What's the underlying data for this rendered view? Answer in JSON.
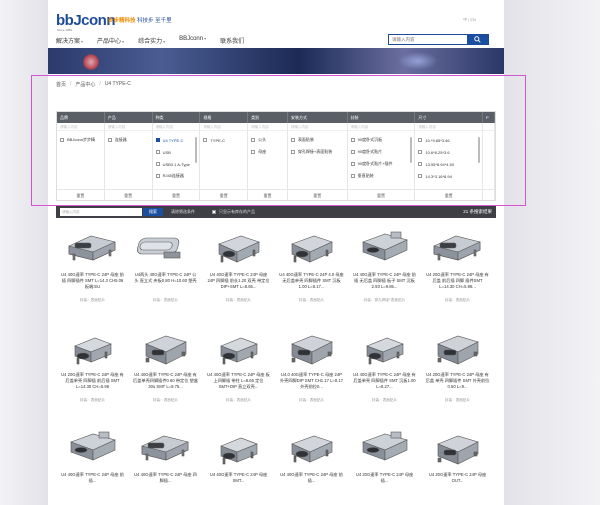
{
  "header": {
    "logo": "bbJconn",
    "logo_sub": "Since 1989",
    "slogan_brand": "步步精科技",
    "slogan_text": "科技步 至千里",
    "lang": "中 | EN",
    "nav": [
      {
        "label": "解决方案",
        "caret": "▾"
      },
      {
        "label": "产品中心",
        "caret": "▾"
      },
      {
        "label": "综合实力",
        "caret": "▾"
      },
      {
        "label": "BBJconn",
        "caret": "▾"
      },
      {
        "label": "联系我们",
        "caret": ""
      }
    ],
    "search_placeholder": "请输入内容"
  },
  "breadcrumb": [
    "首页",
    "产品中心",
    "U4 TYPE-C"
  ],
  "filter": {
    "columns": [
      "品牌",
      "产品",
      "种类",
      "规格",
      "类别",
      "安装方式",
      "封装",
      "尺寸",
      "P"
    ],
    "search_placeholder": "请输入内容",
    "options": {
      "brand": [
        {
          "label": "BBJconn步步精",
          "on": false
        }
      ],
      "product": [
        {
          "label": "连接器",
          "on": false
        }
      ],
      "kind": [
        {
          "label": "U4 TYPE-C",
          "on": true
        },
        {
          "label": "USB",
          "on": false
        },
        {
          "label": "USB3.1 A-Type",
          "on": false
        },
        {
          "label": "RJ45连接器",
          "on": false
        }
      ],
      "spec": [
        {
          "label": "TYPE-C",
          "on": false
        }
      ],
      "category": [
        {
          "label": "公头",
          "on": false
        },
        {
          "label": "母座",
          "on": false
        }
      ],
      "mount": [
        {
          "label": "表面贴装",
          "on": false
        },
        {
          "label": "穿孔焊接+表面贴装",
          "on": false
        }
      ],
      "package": [
        {
          "label": "90度卧式沉板",
          "on": false
        },
        {
          "label": "90度卧式贴片",
          "on": false
        },
        {
          "label": "90度卧式贴片+插件",
          "on": false
        },
        {
          "label": "垂直贴装",
          "on": false
        }
      ],
      "size": [
        {
          "label": "10.*9.85*3.46",
          "on": false
        },
        {
          "label": "10.6*8.25*3.6",
          "on": false
        },
        {
          "label": "13.95*8.94*4.50",
          "on": false
        },
        {
          "label": "14.3*3.16*8.94",
          "on": false
        }
      ]
    },
    "reset": "重置"
  },
  "toolbar": {
    "search_placeholder": "请输入内容",
    "search_btn": "搜索",
    "clear": "清除筛选条件",
    "only_label": "只显示有库存的产品",
    "count": "21 条搜索结果"
  },
  "products": [
    {
      "name": "U4 40G速率 TYPE-C 24P 母座 前插 四脚插件 SMT L=14.3 CH5.06 板端:EU",
      "meta": "封装：表面贴片",
      "shape": "a"
    },
    {
      "name": "U4两头 40G速率 TYPE-C 24P 公头 直立式 夹板0.80 H=10.60 塑壳",
      "meta": "封装：表面贴片",
      "shape": "b"
    },
    {
      "name": "U4 40G速率 TYPE-C 24P 母座 24P 四脚插 前长1.20 双壳 带定位DIP+SMT L=8.65...",
      "meta": "封装：表面贴片",
      "shape": "c"
    },
    {
      "name": "U4 40G速率 TYPE-C 24P 4.0 母座 无后盖单壳 四脚插件 SMT 沉板1.00 L=8.17...",
      "meta": "封装：表面贴片",
      "shape": "c"
    },
    {
      "name": "U4 40G速率 TYPE-C 24P 母座 前插 无后盖 四脚插 板子 SMT 沉板2.93 L=9.85...",
      "meta": "封装：穿孔焊接+表面贴片",
      "shape": "d"
    },
    {
      "name": "U4 20G速率 TYPE-C 24P 母座 有后盖 前后插 四脚 插件SMT L=14.30 CH=5.98...",
      "meta": "封装：表面贴片",
      "shape": "a"
    },
    {
      "name": "U4 20G速率 TYPE-C 24P 母座 有后盖单壳 四脚插 前后插 SMT L=14.30 CH=5.98",
      "meta": "封装：表面贴片",
      "shape": "e"
    },
    {
      "name": "U4 40G速率 TYPE-C 24P 母座 有后盖单壳四脚插件0.60 带定位 塑盒30u SMT L=9.75...",
      "meta": "封装：表面贴片",
      "shape": "f"
    },
    {
      "name": "U4 40G速率 TYPE-C 24P 母座 板上四脚插 带柱 L=8.65 定位SMT+DIP 直立双壳...",
      "meta": "封装：表面贴片",
      "shape": "e"
    },
    {
      "name": "U4.0 40G速率 TYPE-C 母座 24P 外壳四脚DIP SMT CH1.17 L=8.17 外壳前拉0...",
      "meta": "封装：表面贴片",
      "shape": "f"
    },
    {
      "name": "U4 40G速率 TYPE-C 24P 母座 有后盖单壳 四脚插件 SMT 沉板1.00 L=8.27...",
      "meta": "封装：表面贴片",
      "shape": "e"
    },
    {
      "name": "U4 20G速率 TYPE-C 24P 母座 有后盖 单壳 四脚插件 SMT 外壳前拉0.50 L=9...",
      "meta": "封装：表面贴片",
      "shape": "f"
    },
    {
      "name": "U4 40G速率 TYPE-C 24P 母座 前插...",
      "meta": "",
      "shape": "d"
    },
    {
      "name": "U4 40G速率 TYPE-C 24P 母座 四脚插...",
      "meta": "",
      "shape": "a"
    },
    {
      "name": "U4 40G速率 TYPE-C 24P 母座 SMT...",
      "meta": "",
      "shape": "e"
    },
    {
      "name": "U4 40G速率 TYPE-C 24P 母座 前插...",
      "meta": "",
      "shape": "c"
    },
    {
      "name": "U4 20G速率 TYPE-C 24P 母座 插...",
      "meta": "",
      "shape": "d"
    },
    {
      "name": "U4 20G速率 TYPE-C 24P 母座 OUT...",
      "meta": "",
      "shape": "f"
    }
  ]
}
